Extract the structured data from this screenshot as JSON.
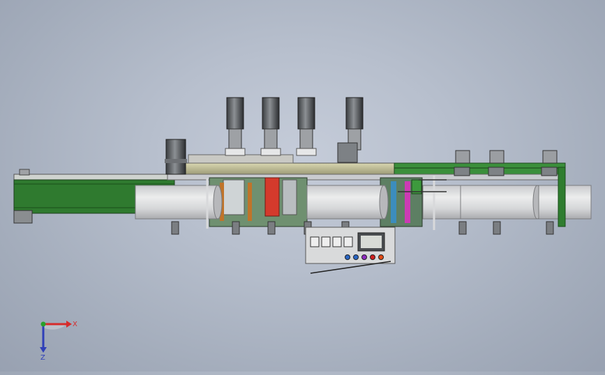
{
  "viewport": {
    "background": "#b9c0cc",
    "accent_green": "#2f7d2f",
    "housing_gray": "#d6d8dc"
  },
  "model": {
    "servo_motor_count": 4,
    "top_cylinder_count": 3,
    "control_buttons": 5,
    "button_colors": [
      "#2a66c4",
      "#2a66c4",
      "#8e2bbf",
      "#d11f1f",
      "#e14b14"
    ]
  },
  "triad": {
    "x_label": "X",
    "z_label": "Z",
    "y_color": "#2aa02a"
  }
}
